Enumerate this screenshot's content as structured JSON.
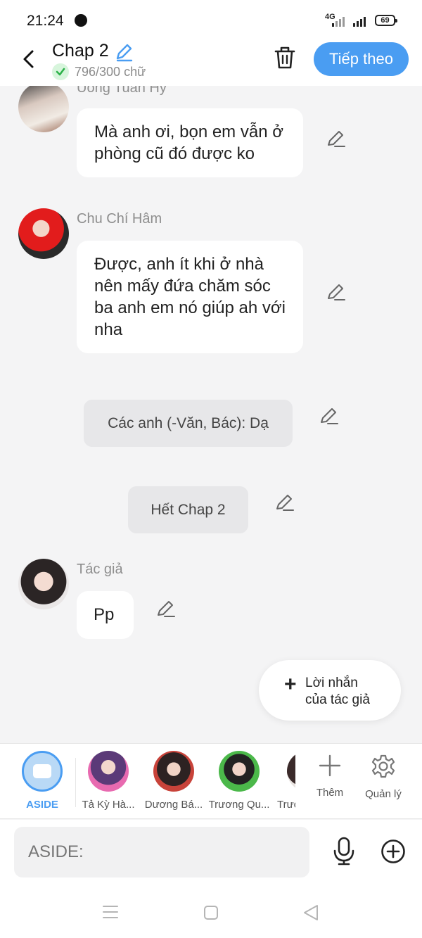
{
  "status": {
    "time": "21:24",
    "network": "4G",
    "battery": "69"
  },
  "header": {
    "title": "Chap 2",
    "word_count": "796/300 chữ",
    "next_label": "Tiếp theo"
  },
  "messages": [
    {
      "name": "Uông Tuấn Hy",
      "text": "Mà anh ơi, bọn em vẫn ở phòng cũ đó được ko"
    },
    {
      "name": "Chu Chí Hâm",
      "text": "Được, anh ít khi ở nhà nên mấy đứa chăm sóc ba anh em nó giúp ah với nha"
    },
    {
      "text": "Các anh (-Văn, Bác): Dạ"
    },
    {
      "text": "Hết Chap 2"
    },
    {
      "name": "Tác giả",
      "text": "Pp"
    }
  ],
  "author_note": {
    "line1": "Lời nhắn",
    "line2": "của tác giả"
  },
  "characters": [
    {
      "label": "ASIDE"
    },
    {
      "label": "Tả Kỳ Hà..."
    },
    {
      "label": "Dương Bá..."
    },
    {
      "label": "Trương Qu..."
    },
    {
      "label": "Trươ"
    }
  ],
  "actions": {
    "more_label": "Thêm",
    "manage_label": "Quản lý"
  },
  "input": {
    "placeholder": "ASIDE:"
  },
  "colors": {
    "accent": "#4a9df2",
    "bubble": "#ffffff",
    "narration": "#e7e7e9",
    "background": "#f4f4f5"
  }
}
